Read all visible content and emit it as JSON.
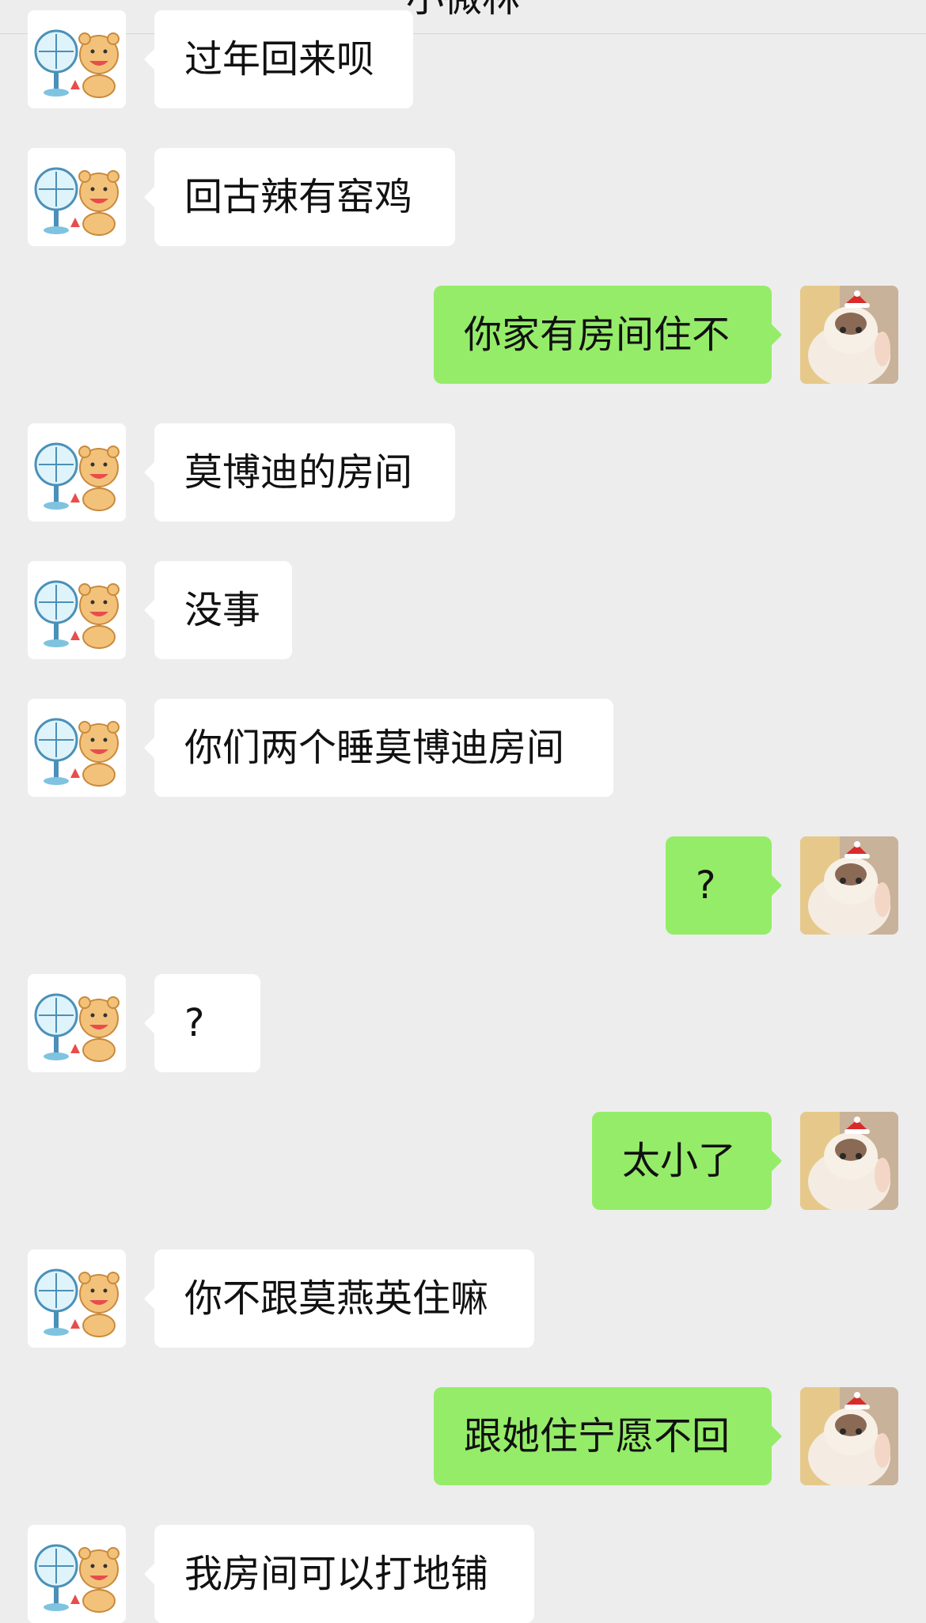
{
  "header": {
    "title": "小微林"
  },
  "messages": [
    {
      "side": "them",
      "text": "过年回来呗"
    },
    {
      "side": "them",
      "text": "回古辣有窑鸡"
    },
    {
      "side": "me",
      "text": "你家有房间住不"
    },
    {
      "side": "them",
      "text": "莫博迪的房间"
    },
    {
      "side": "them",
      "text": "没事"
    },
    {
      "side": "them",
      "text": "你们两个睡莫博迪房间"
    },
    {
      "side": "me",
      "text": "?"
    },
    {
      "side": "them",
      "text": "?"
    },
    {
      "side": "me",
      "text": "太小了"
    },
    {
      "side": "them",
      "text": "你不跟莫燕英住嘛"
    },
    {
      "side": "me",
      "text": "跟她住宁愿不回"
    },
    {
      "side": "them",
      "text": "我房间可以打地铺"
    }
  ],
  "avatars": {
    "them": "fan-and-bear-avatar-icon",
    "me": "cat-with-santa-hat-avatar-icon"
  },
  "colors": {
    "background": "#ededed",
    "incoming_bubble": "#ffffff",
    "outgoing_bubble": "#95ec69"
  }
}
